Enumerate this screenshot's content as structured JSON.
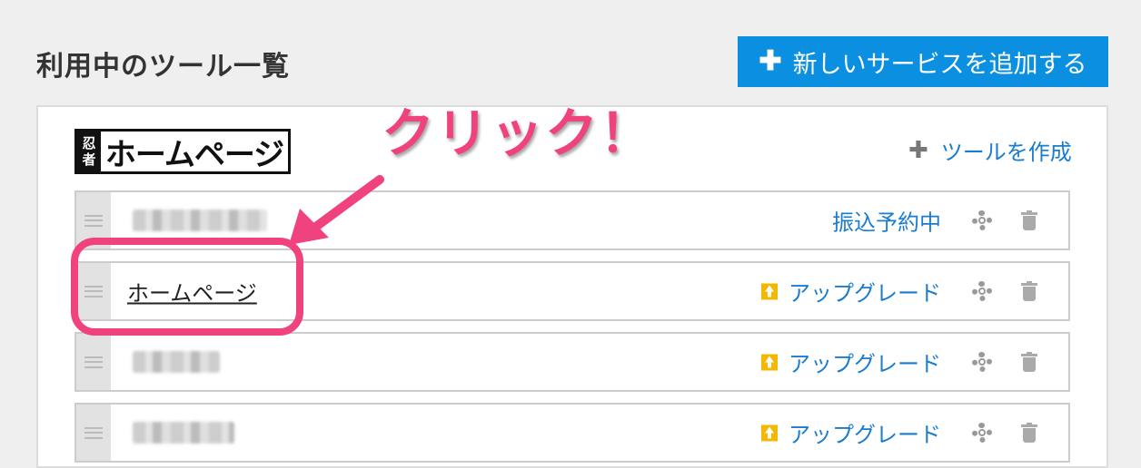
{
  "header": {
    "title": "利用中のツール一覧",
    "add_button_label": "新しいサービスを追加する",
    "add_button_icon": "plus-icon"
  },
  "panel": {
    "logo": {
      "seal_chars": [
        "忍",
        "者"
      ],
      "text": "ホームページ"
    },
    "create_tool_label": "ツールを作成",
    "rows": [
      {
        "name": "",
        "name_blurred": true,
        "status": "振込予約中",
        "status_icon": null
      },
      {
        "name": "ホームページ",
        "name_blurred": false,
        "status": "アップグレード",
        "status_icon": "upgrade-icon"
      },
      {
        "name": "",
        "name_blurred": true,
        "status": "アップグレード",
        "status_icon": "upgrade-icon"
      },
      {
        "name": "",
        "name_blurred": true,
        "status": "アップグレード",
        "status_icon": "upgrade-icon"
      }
    ]
  },
  "annotation": {
    "callout_text": "クリック！",
    "color": "#f0427e"
  },
  "colors": {
    "accent": "#0b8fe0",
    "link": "#1a7ccf",
    "upgrade": "#f5b800"
  }
}
